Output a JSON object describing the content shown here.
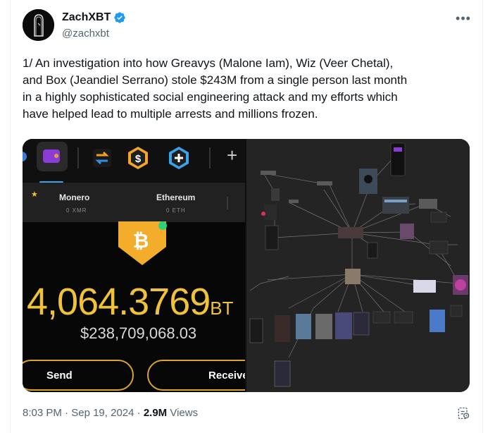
{
  "author": {
    "name": "ZachXBT",
    "handle": "@zachxbt",
    "verified_color": "#1d9bf0"
  },
  "more_label": "•••",
  "tweet": {
    "text": "1/ An investigation into how Greavys (Malone Iam), Wiz (Veer Chetal),\nand Box (Jeandiel Serrano) stole $243M from a single person last month\nin a highly sophisticated social engineering attack and my efforts which\nhave helped lead to multiple arrests and millions frozen."
  },
  "media": {
    "wallet": {
      "tabs": [
        {
          "label": "Monero",
          "sub": "0 XMR"
        },
        {
          "label": "Ethereum",
          "sub": "0 ETH"
        }
      ],
      "plus_label": "+",
      "amount": "4,064.3769",
      "amount_unit": "BT",
      "usd": "$238,709,068.03",
      "send_label": "Send",
      "receive_label": "Receive",
      "accent_color": "#f0c23a"
    }
  },
  "footer": {
    "time": "8:03 PM",
    "sep1": " · ",
    "date": "Sep 19, 2024",
    "sep2": " · ",
    "views_count": "2.9M",
    "views_label": " Views"
  }
}
